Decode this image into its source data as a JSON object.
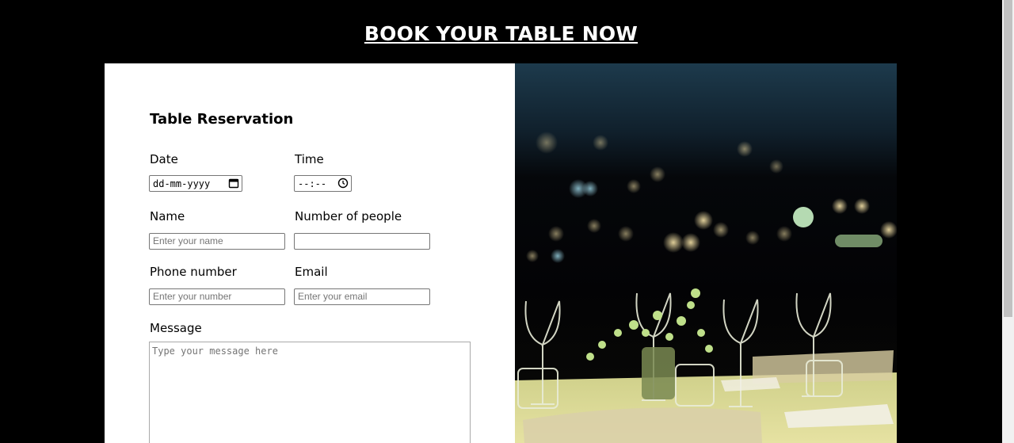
{
  "page": {
    "heading": "BOOK YOUR TABLE NOW"
  },
  "form": {
    "title": "Table Reservation",
    "date": {
      "label": "Date",
      "value": "dd-mm-yyyy",
      "icon": "calendar-icon"
    },
    "time": {
      "label": "Time",
      "value": "--:--",
      "icon": "clock-icon"
    },
    "name": {
      "label": "Name",
      "placeholder": "Enter your name"
    },
    "people": {
      "label": "Number of people",
      "placeholder": ""
    },
    "phone": {
      "label": "Phone number",
      "placeholder": "Enter your number"
    },
    "email": {
      "label": "Email",
      "placeholder": "Enter your email"
    },
    "message": {
      "label": "Message",
      "placeholder": "Type your message here"
    }
  },
  "colors": {
    "background": "#000000",
    "card": "#ffffff",
    "table_light": "#e8e2a0"
  }
}
